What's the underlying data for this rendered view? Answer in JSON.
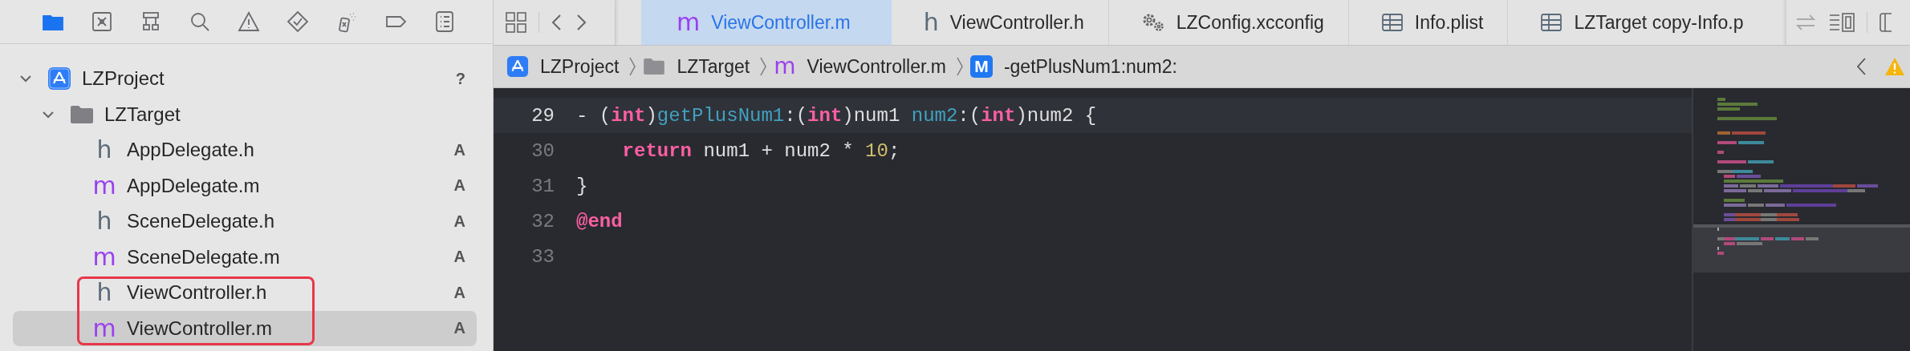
{
  "navigator_tabs": [
    {
      "kind": "folder",
      "selected": true
    },
    {
      "kind": "source-control",
      "selected": false
    },
    {
      "kind": "hierarchy",
      "selected": false
    },
    {
      "kind": "search",
      "selected": false
    },
    {
      "kind": "warning",
      "selected": false
    },
    {
      "kind": "test",
      "selected": false
    },
    {
      "kind": "debug",
      "selected": false
    },
    {
      "kind": "breakpoint",
      "selected": false
    },
    {
      "kind": "report",
      "selected": false
    }
  ],
  "tree": [
    {
      "kind": "project",
      "name": "LZProject",
      "status": "?",
      "expanded": true,
      "selected": false,
      "children": [
        {
          "kind": "folder",
          "name": "LZTarget",
          "expanded": true,
          "selected": false,
          "children": [
            {
              "kind": "header",
              "glyph": "h",
              "name": "AppDelegate.h",
              "status": "A",
              "selected": false,
              "outlined": false
            },
            {
              "kind": "implementation",
              "glyph": "m",
              "name": "AppDelegate.m",
              "status": "A",
              "selected": false,
              "outlined": false
            },
            {
              "kind": "header",
              "glyph": "h",
              "name": "SceneDelegate.h",
              "status": "A",
              "selected": false,
              "outlined": false
            },
            {
              "kind": "implementation",
              "glyph": "m",
              "name": "SceneDelegate.m",
              "status": "A",
              "selected": false,
              "outlined": false
            },
            {
              "kind": "header",
              "glyph": "h",
              "name": "ViewController.h",
              "status": "A",
              "selected": false,
              "outlined": true
            },
            {
              "kind": "implementation",
              "glyph": "m",
              "name": "ViewController.m",
              "status": "A",
              "selected": true,
              "outlined": true
            }
          ]
        }
      ]
    }
  ],
  "tabs": [
    {
      "kind": "implementation",
      "glyph": "m",
      "label": "ViewController.m",
      "selected": true
    },
    {
      "kind": "header",
      "glyph": "h",
      "label": "ViewController.h",
      "selected": false
    },
    {
      "kind": "config",
      "label": "LZConfig.xcconfig",
      "selected": false
    },
    {
      "kind": "plist",
      "label": "Info.plist",
      "selected": false
    },
    {
      "kind": "plist",
      "label": "LZTarget copy-Info.p",
      "selected": false
    }
  ],
  "breadcrumbs": [
    {
      "kind": "project",
      "label": "LZProject"
    },
    {
      "kind": "folder",
      "label": "LZTarget"
    },
    {
      "kind": "implementation",
      "glyph": "m",
      "label": "ViewController.m"
    },
    {
      "kind": "method",
      "glyph": "M",
      "label": "-getPlusNum1:num2:"
    }
  ],
  "code": [
    {
      "number": "29",
      "current": true,
      "indented": false,
      "tokens": [
        {
          "kind": "plain",
          "text": "- ("
        },
        {
          "kind": "keyword",
          "text": "int"
        },
        {
          "kind": "plain",
          "text": ")"
        },
        {
          "kind": "declaration",
          "text": "getPlusNum1"
        },
        {
          "kind": "plain",
          "text": ":("
        },
        {
          "kind": "keyword",
          "text": "int"
        },
        {
          "kind": "plain",
          "text": ")num1 "
        },
        {
          "kind": "declaration",
          "text": "num2"
        },
        {
          "kind": "plain",
          "text": ":("
        },
        {
          "kind": "keyword",
          "text": "int"
        },
        {
          "kind": "plain",
          "text": ")num2 {"
        }
      ]
    },
    {
      "number": "30",
      "current": false,
      "indented": true,
      "tokens": [
        {
          "kind": "keyword",
          "text": "return"
        },
        {
          "kind": "plain",
          "text": " num1 + num2 * "
        },
        {
          "kind": "number",
          "text": "10"
        },
        {
          "kind": "plain",
          "text": ";"
        }
      ]
    },
    {
      "number": "31",
      "current": false,
      "indented": false,
      "tokens": [
        {
          "kind": "plain",
          "text": "}"
        }
      ]
    },
    {
      "number": "32",
      "current": false,
      "indented": false,
      "tokens": [
        {
          "kind": "keyword",
          "text": "@end"
        }
      ]
    },
    {
      "number": "33",
      "current": false
    }
  ]
}
